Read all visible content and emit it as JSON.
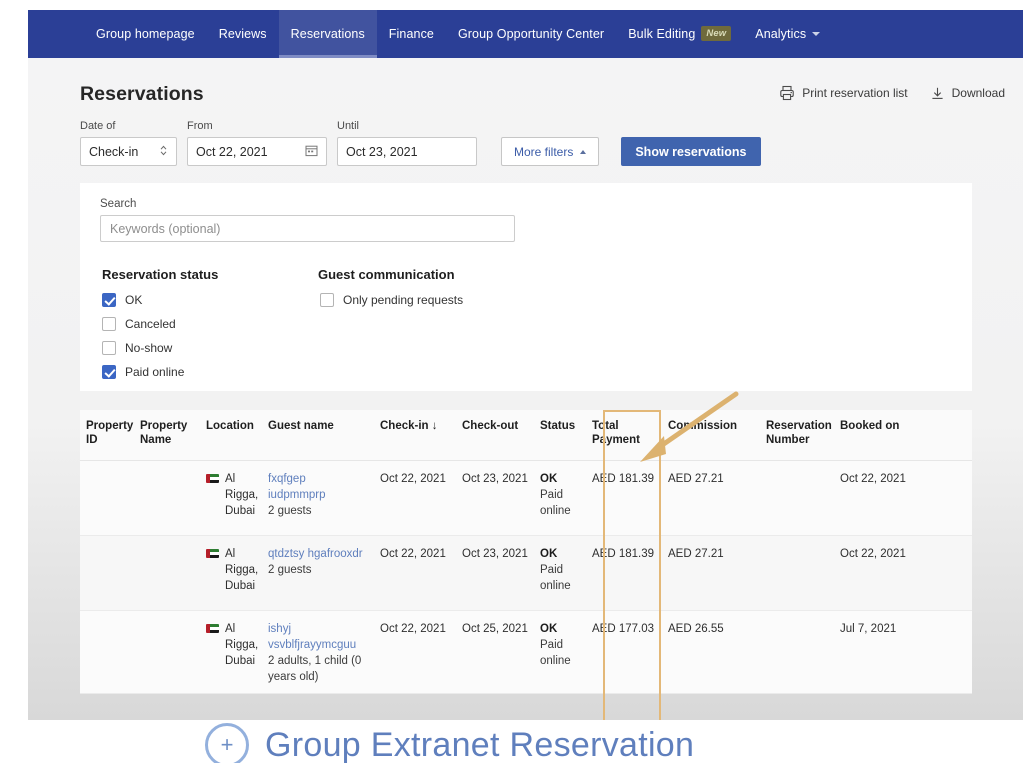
{
  "nav": {
    "items": [
      {
        "label": "Group homepage",
        "active": false,
        "badge": null,
        "caret": false
      },
      {
        "label": "Reviews",
        "active": false,
        "badge": null,
        "caret": false
      },
      {
        "label": "Reservations",
        "active": true,
        "badge": null,
        "caret": false
      },
      {
        "label": "Finance",
        "active": false,
        "badge": null,
        "caret": false
      },
      {
        "label": "Group Opportunity Center",
        "active": false,
        "badge": null,
        "caret": false
      },
      {
        "label": "Bulk Editing",
        "active": false,
        "badge": "New",
        "caret": false
      },
      {
        "label": "Analytics",
        "active": false,
        "badge": null,
        "caret": true
      }
    ]
  },
  "header": {
    "title": "Reservations",
    "print_label": "Print reservation list",
    "download_label": "Download",
    "print_icon": "printer-icon",
    "download_icon": "download-icon"
  },
  "filterbar": {
    "date_of_label": "Date of",
    "date_of_value": "Check-in",
    "from_label": "From",
    "from_value": "Oct 22, 2021",
    "until_label": "Until",
    "until_value": "Oct 23, 2021",
    "more_filters_label": "More filters",
    "show_reservations_label": "Show reservations",
    "calendar_icon": "calendar-icon",
    "stepper_icon": "updown-chevron-icon",
    "chevron_up_icon": "chevron-up-icon"
  },
  "panel": {
    "search_label": "Search",
    "search_placeholder": "Keywords (optional)",
    "search_value": "",
    "reservation_status_title": "Reservation status",
    "guest_communication_title": "Guest communication",
    "status_options": [
      {
        "label": "OK",
        "checked": true
      },
      {
        "label": "Canceled",
        "checked": false
      },
      {
        "label": "No-show",
        "checked": false
      },
      {
        "label": "Paid online",
        "checked": true
      }
    ],
    "communication_options": [
      {
        "label": "Only pending requests",
        "checked": false
      }
    ]
  },
  "table": {
    "columns": [
      "Property ID",
      "Property Name",
      "Location",
      "Guest name",
      "Check-in ↓",
      "Check-out",
      "Status",
      "Total Payment",
      "Commission",
      "Reservation Number",
      "Booked on"
    ],
    "sort_column": "Check-in",
    "sort_direction": "descending",
    "rows": [
      {
        "property_id": "",
        "property_name": "",
        "location": "Al Rigga, Dubai",
        "location_flag": "uae-flag-icon",
        "guest_name_line1": "fxqfgep",
        "guest_name_line2": "iudpmmprp",
        "guest_count": "2 guests",
        "check_in": "Oct 22, 2021",
        "check_out": "Oct 23, 2021",
        "status": "OK",
        "status_sub": "Paid online",
        "total_payment": "AED 181.39",
        "commission": "AED 27.21",
        "reservation_number": "",
        "booked_on": "Oct 22, 2021"
      },
      {
        "property_id": "",
        "property_name": "",
        "location": "Al Rigga, Dubai",
        "location_flag": "uae-flag-icon",
        "guest_name_line1": "qtdztsy hgafrooxdr",
        "guest_name_line2": "",
        "guest_count": "2 guests",
        "check_in": "Oct 22, 2021",
        "check_out": "Oct 23, 2021",
        "status": "OK",
        "status_sub": "Paid online",
        "total_payment": "AED 181.39",
        "commission": "AED 27.21",
        "reservation_number": "",
        "booked_on": "Oct 22, 2021"
      },
      {
        "property_id": "",
        "property_name": "",
        "location": "Al Rigga, Dubai",
        "location_flag": "uae-flag-icon",
        "guest_name_line1": "ishyj",
        "guest_name_line2": "vsvblfjrayymcguu",
        "guest_count": "2 adults, 1 child (0 years old)",
        "check_in": "Oct 22, 2021",
        "check_out": "Oct 25, 2021",
        "status": "OK",
        "status_sub": "Paid online",
        "total_payment": "AED 177.03",
        "commission": "AED 26.55",
        "reservation_number": "",
        "booked_on": "Jul 7, 2021"
      }
    ]
  },
  "annotation": {
    "highlight_target": "status-column",
    "arrow_color": "#dcb26f",
    "highlight_color": "#e3b878"
  },
  "caption": {
    "text": "Group Extranet Reservation",
    "icon": "plus-circle-icon",
    "color": "#5f7fbd"
  },
  "colors": {
    "nav_bg": "#2b3f96",
    "nav_active": "#41539f",
    "primary_button": "#4064ae",
    "link": "#5f7fbd",
    "badge_new_bg": "#6f6a3c"
  }
}
